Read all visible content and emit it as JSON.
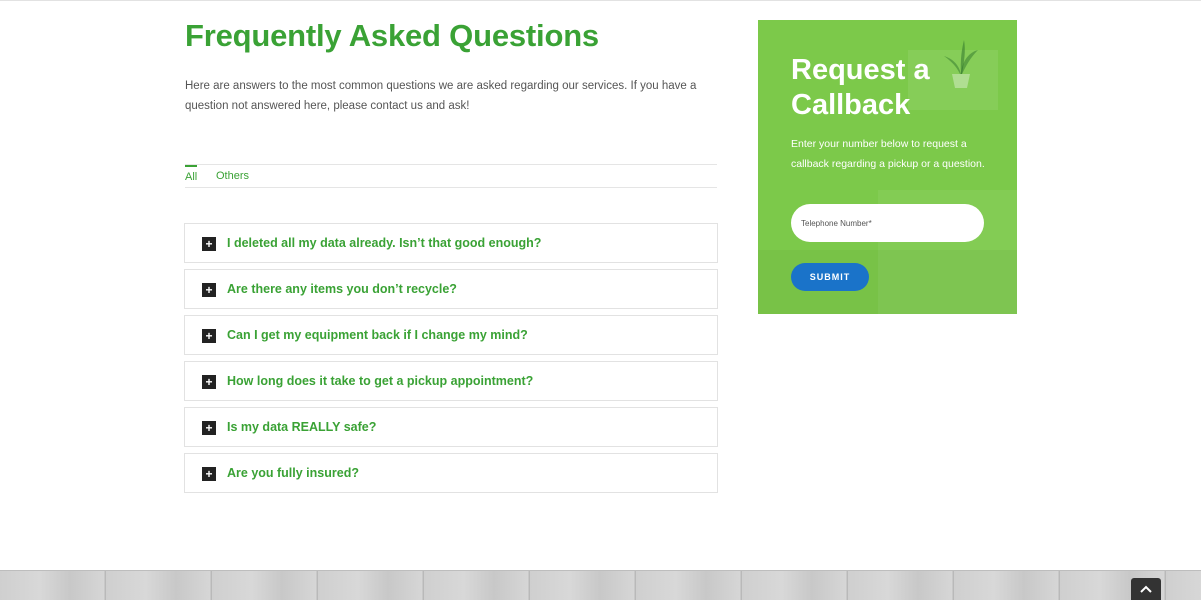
{
  "faq": {
    "title": "Frequently Asked Questions",
    "intro": "Here are answers to the most common questions we are asked regarding our services. If you have a question not answered here, please contact us and ask!",
    "tabs": [
      {
        "label": "All",
        "active": true
      },
      {
        "label": "Others",
        "active": false
      }
    ],
    "toggle_symbol": "+",
    "questions": [
      "I deleted all my data already. Isn’t that good enough?",
      "Are there any items you don’t recycle?",
      "Can I get my equipment back if I change my mind?",
      "How long does it take to get a pickup appointment?",
      "Is my data REALLY safe?",
      "Are you fully insured?"
    ]
  },
  "callback": {
    "title": "Request a Callback",
    "text": "Enter your number below to request a callback regarding a pickup or a question.",
    "phone_placeholder": "Telephone Number*",
    "phone_value": "",
    "submit_label": "SUBMIT"
  },
  "icons": {
    "expand": "plus-icon",
    "to_top": "chevron-up-icon",
    "decor": "plant-icon"
  },
  "colors": {
    "accent_green": "#3aa235",
    "panel_green": "#7cc94a",
    "button_blue": "#1a73c9"
  }
}
